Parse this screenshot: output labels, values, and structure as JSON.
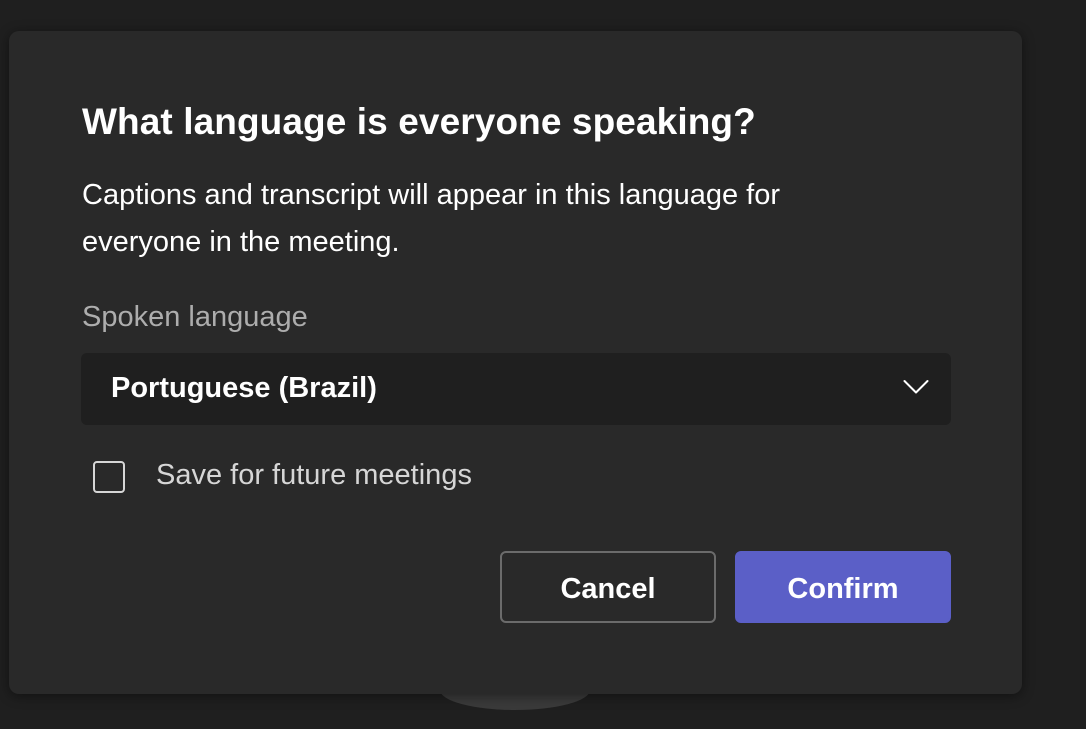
{
  "dialog": {
    "title": "What language is everyone speaking?",
    "description": "Captions and transcript will appear in this language for everyone in the meeting.",
    "field_label": "Spoken language",
    "selected_language": "Portuguese (Brazil)",
    "dropdown_icon": "chevron-down-icon",
    "save_checkbox": {
      "label": "Save for future meetings",
      "checked": false
    },
    "buttons": {
      "cancel": "Cancel",
      "confirm": "Confirm"
    }
  },
  "colors": {
    "dialog_background": "#292929",
    "select_background": "#1f1f1f",
    "accent": "#5b5fc7",
    "muted_text": "#adadad"
  }
}
